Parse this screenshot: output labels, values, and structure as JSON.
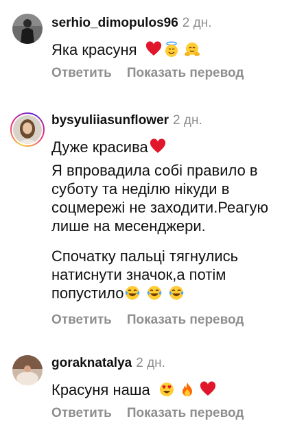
{
  "comments": [
    {
      "username": "serhio_dimopulos96",
      "time": "2 дн.",
      "lines": [
        "Яка красуня"
      ],
      "emojis": [
        "red-heart",
        "halo-face",
        "hugging-face"
      ],
      "reply_label": "Ответить",
      "translate_label": "Показать перевод"
    },
    {
      "username": "bysyuliiasunflower",
      "time": "2 дн.",
      "line1": "Дуже красива",
      "para2": [
        "Я впровадила собі правило в",
        "суботу та неділю нікуди в",
        "соцмережі не заходити.Реагую",
        "лише на месенджери."
      ],
      "para3": [
        "Спочатку пальці тягнулись",
        "натиснути значок,а потім",
        "попустило"
      ],
      "emojis_line1": [
        "red-heart"
      ],
      "emojis_end": [
        "tears-of-joy",
        "tears-of-joy",
        "tears-of-joy"
      ],
      "reply_label": "Ответить",
      "translate_label": "Показать перевод"
    },
    {
      "username": "goraknatalya",
      "time": "2 дн.",
      "lines": [
        "Красуня наша"
      ],
      "emojis": [
        "heart-eyes",
        "fire",
        "red-heart"
      ],
      "reply_label": "Ответить",
      "translate_label": "Показать перевод"
    }
  ],
  "colors": {
    "text": "#111111",
    "muted": "#8e8e8e",
    "heart": "#e0162b"
  }
}
